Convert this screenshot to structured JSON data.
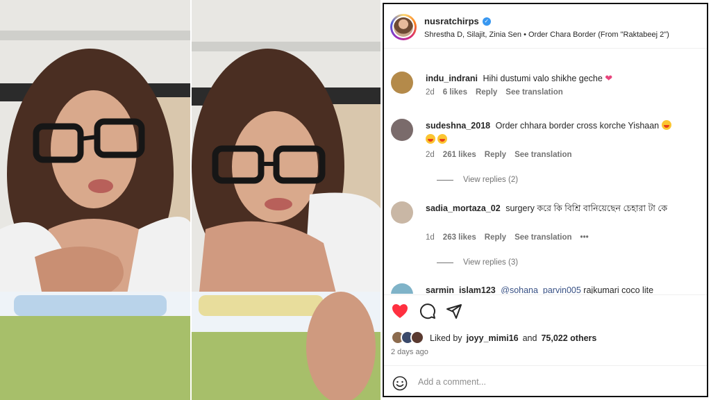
{
  "post": {
    "username": "nusratchirps",
    "audio": "Shrestha D, Silajit, Zinia Sen • Order Chara Border (From \"Raktabeej 2\")"
  },
  "comments": [
    {
      "user": "indu_indrani",
      "text": "Hihi dustumi valo shikhe geche",
      "emoji": "heart",
      "time": "2d",
      "likes": "6 likes",
      "reply": "Reply",
      "translate": "See translation",
      "avatar_color": "#b48a4a"
    },
    {
      "user": "sudeshna_2018",
      "text": "Order chhara border cross korche Yishaan",
      "emoji": "laugh",
      "time": "2d",
      "likes": "261 likes",
      "reply": "Reply",
      "translate": "See translation",
      "view_replies": "View replies (2)",
      "avatar_color": "#7a6b6b"
    },
    {
      "user": "sadia_mortaza_02",
      "text": "surgery করে কি বিশ্রি বানিয়েছেন চেহারা টা কে",
      "time": "1d",
      "likes": "263 likes",
      "reply": "Reply",
      "translate": "See translation",
      "more": "•••",
      "view_replies": "View replies (3)",
      "avatar_color": "#c9b7a5"
    },
    {
      "user": "sarmin_islam123",
      "mention": "@sohana_parvin005",
      "text": "rajkumari coco lite",
      "avatar_color": "#7fb3c8"
    }
  ],
  "likes": {
    "prefix": "Liked by",
    "user": "joyy_mimi16",
    "middle": "and",
    "others": "75,022 others"
  },
  "date": "2 days ago",
  "add_comment": {
    "placeholder": "Add a comment..."
  },
  "icons": {
    "like": "heart-filled-icon",
    "comment": "speech-bubble-icon",
    "share": "paper-plane-icon",
    "emoji": "smiley-icon"
  },
  "colors": {
    "like_red": "#ff3040",
    "verified_blue": "#3897f0",
    "mention_blue": "#385185"
  }
}
